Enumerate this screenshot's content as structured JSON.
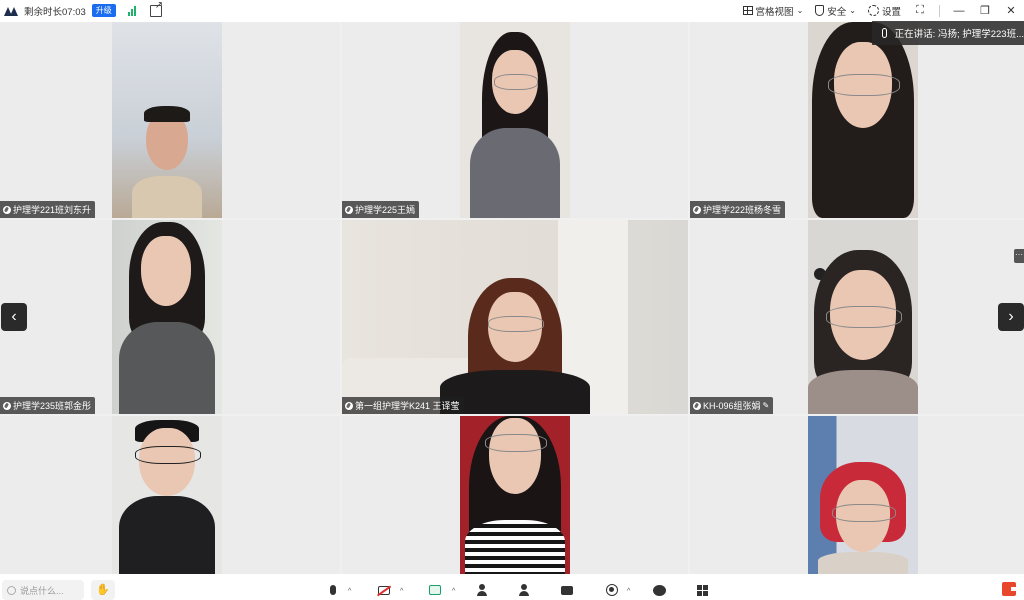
{
  "topbar": {
    "remaining_time": "剩余时长07:03",
    "upgrade_label": "升级",
    "grid_view_label": "宫格视图",
    "security_label": "安全",
    "settings_label": "设置"
  },
  "speaking": {
    "text": "正在讲话:  冯扬; 护理学223班..."
  },
  "participants": [
    {
      "name": "护理学221班刘东升"
    },
    {
      "name": "护理学225王嫣"
    },
    {
      "name": "护理学222班杨冬雪"
    },
    {
      "name": "护理学235班郭金彤"
    },
    {
      "name": "第一组护理学K241 王译莹"
    },
    {
      "name": "KH-096组张娟"
    },
    {
      "name": ""
    },
    {
      "name": ""
    },
    {
      "name": ""
    }
  ],
  "overflow_label": "···",
  "bottombar": {
    "chat_placeholder": "说点什么..."
  },
  "colors": {
    "accent": "#1a6cf0",
    "signal": "#20b26b",
    "share": "#17a06b",
    "end": "#e8472b"
  }
}
